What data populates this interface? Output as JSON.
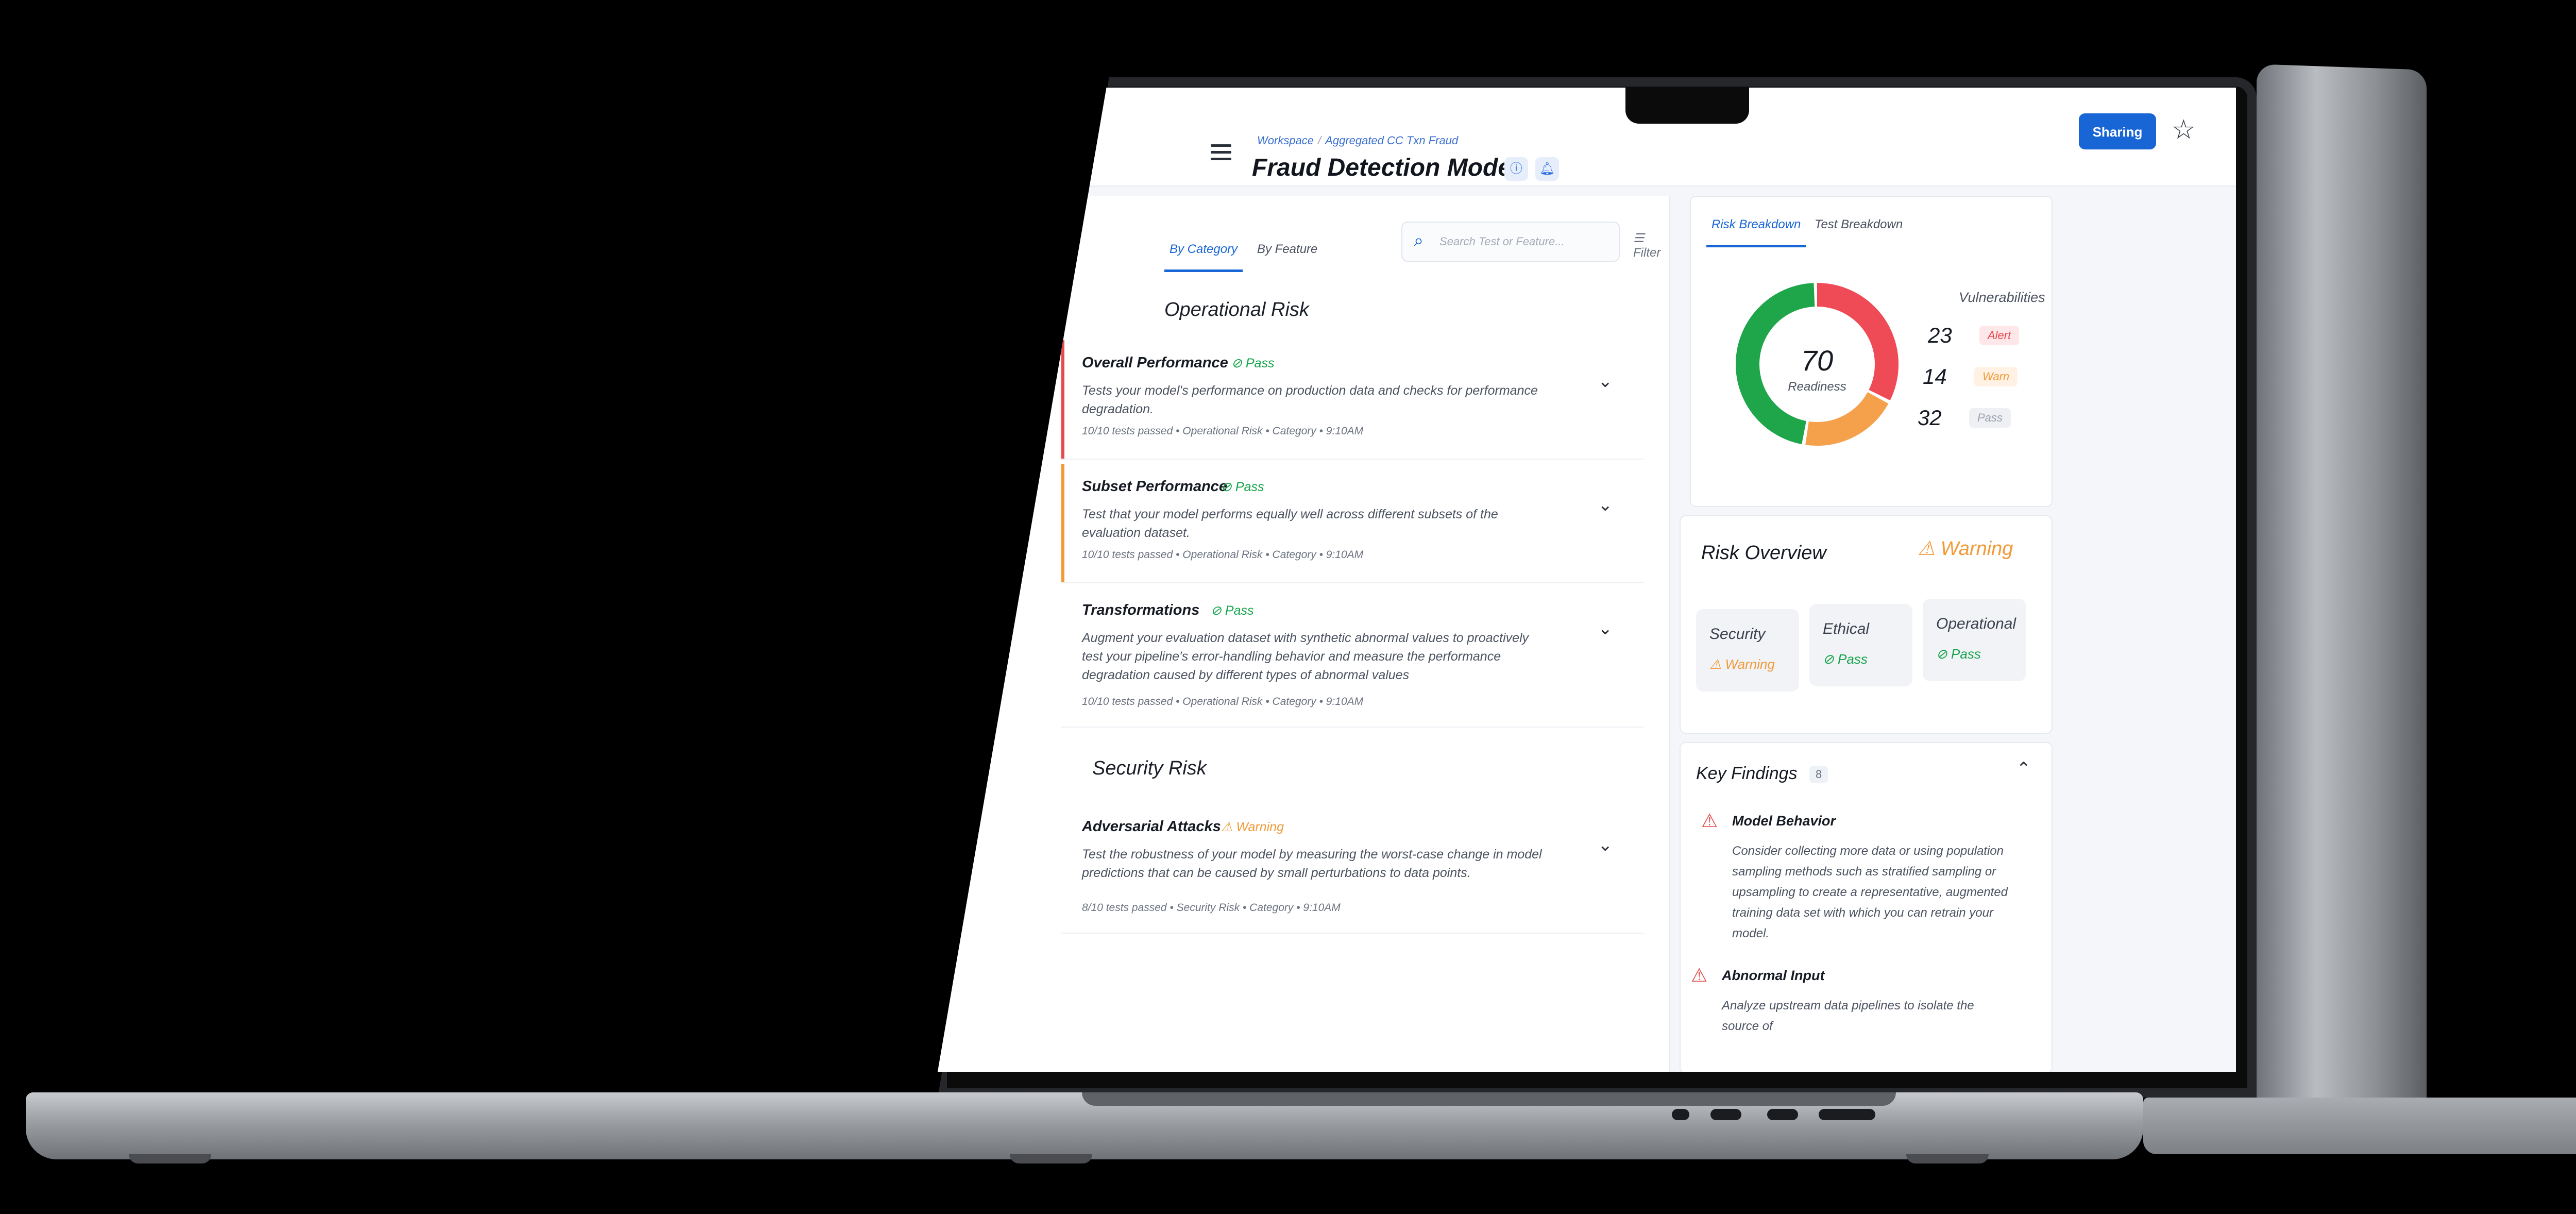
{
  "header": {
    "breadcrumb": [
      "Workspace",
      "Aggregated CC Txn Fraud"
    ],
    "title": "Fraud Detection Model",
    "sharing_label": "Sharing"
  },
  "left": {
    "tabs": [
      {
        "label": "By Category",
        "active": true
      },
      {
        "label": "By Feature",
        "active": false
      }
    ],
    "search_placeholder": "Search Test or Feature...",
    "filter_label": "Filter",
    "sections": [
      {
        "title": "Operational Risk",
        "tests": [
          {
            "name": "Overall Performance",
            "status": "Pass",
            "description": "Tests your model's performance on production data and checks for performance degradation.",
            "meta": "10/10 tests passed  •  Operational Risk  •  Category  •  9:10AM",
            "accent": "#e5484d"
          },
          {
            "name": "Subset Performance",
            "status": "Pass",
            "description": "Test that your model performs equally well across different subsets of the evaluation dataset.",
            "meta": "10/10 tests passed  •  Operational Risk  •  Category  •  9:10AM",
            "accent": "#f19a38"
          },
          {
            "name": "Transformations",
            "status": "Pass",
            "description": "Augment your evaluation dataset with synthetic abnormal values to proactively test your pipeline's error-handling behavior and measure the performance degradation caused by different types of abnormal values",
            "meta": "10/10 tests passed  •  Operational Risk  •  Category  •  9:10AM",
            "accent": "#ffffff"
          }
        ]
      },
      {
        "title": "Security Risk",
        "tests": [
          {
            "name": "Adversarial Attacks",
            "status": "Warning",
            "description": "Test the robustness of your model by measuring the worst-case change in model predictions that can be caused by small perturbations to data points.",
            "meta": "8/10 tests passed  •  Security Risk  •  Category  •  9:10AM",
            "accent": "#ffffff"
          }
        ]
      }
    ]
  },
  "right": {
    "tabs": [
      {
        "label": "Risk Breakdown",
        "active": true
      },
      {
        "label": "Test Breakdown",
        "active": false
      }
    ],
    "readiness": {
      "value": "70",
      "label": "Readiness"
    },
    "donut_segments": [
      {
        "name": "Alert",
        "fraction": 0.33,
        "color": "#ef4b57"
      },
      {
        "name": "Warn",
        "fraction": 0.2,
        "color": "#f5a04a"
      },
      {
        "name": "Pass",
        "fraction": 0.47,
        "color": "#1fa64a"
      }
    ],
    "vulnerabilities": {
      "title": "Vulnerabilities",
      "items": [
        {
          "count": "23",
          "label": "Alert",
          "bg": "#fde7e8",
          "fg": "#e5484d"
        },
        {
          "count": "14",
          "label": "Warn",
          "bg": "#fff1e3",
          "fg": "#f19a38"
        },
        {
          "count": "32",
          "label": "Pass",
          "bg": "#eef0f4",
          "fg": "#9aa1ad"
        }
      ]
    },
    "risk_overview": {
      "title": "Risk Overview",
      "status": "Warning",
      "tiles": [
        {
          "name": "Security",
          "status": "Warning"
        },
        {
          "name": "Ethical",
          "status": "Pass"
        },
        {
          "name": "Operational",
          "status": "Pass"
        }
      ]
    },
    "key_findings": {
      "title": "Key Findings",
      "count": "8",
      "items": [
        {
          "title": "Model Behavior",
          "description": "Consider collecting more data or using population sampling methods such as stratified sampling or upsampling to create a representative, augmented training data set with which you can retrain your model."
        },
        {
          "title": "Abnormal Input",
          "description": "Analyze upstream data pipelines to isolate the source of"
        }
      ]
    }
  }
}
